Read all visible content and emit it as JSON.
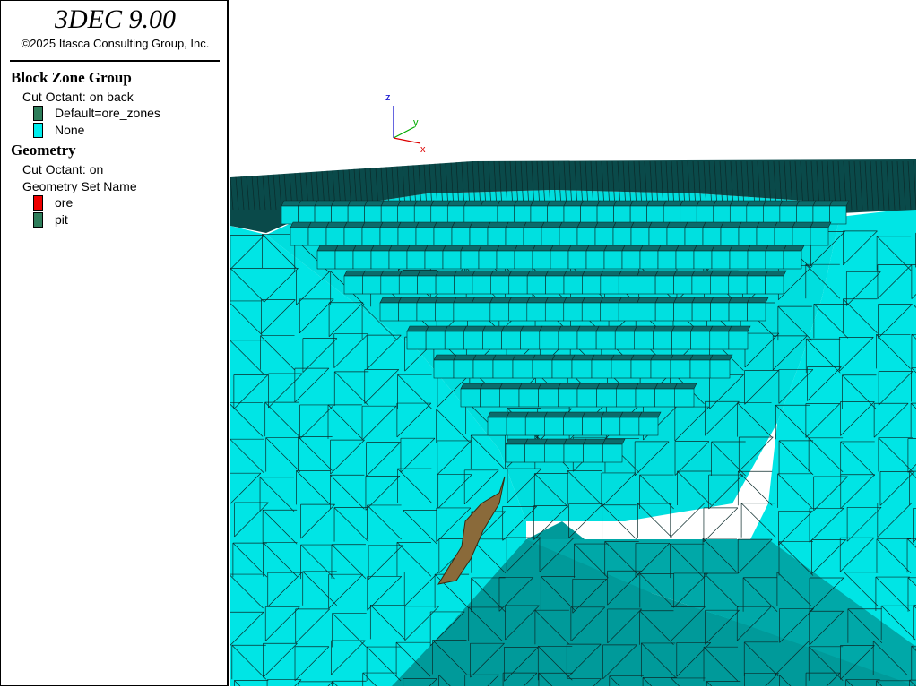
{
  "header": {
    "app_title": "3DEC 9.00",
    "copyright": "©2025 Itasca Consulting Group, Inc."
  },
  "legend": {
    "block_zone_group": {
      "title": "Block  Zone Group",
      "cut_octant": "Cut Octant: on back",
      "items": [
        {
          "label": "Default=ore_zones",
          "color": "#2e7d5a"
        },
        {
          "label": "None",
          "color": "#00eeee"
        }
      ]
    },
    "geometry": {
      "title": "Geometry",
      "cut_octant": "Cut Octant: on",
      "set_name_label": "Geometry Set Name",
      "items": [
        {
          "label": "ore",
          "color": "#ee0000"
        },
        {
          "label": "pit",
          "color": "#2e7d5a"
        }
      ]
    }
  },
  "axes": {
    "z": "z",
    "y": "y",
    "x": "x",
    "z_color": "#0000cc",
    "y_color": "#00aa00",
    "x_color": "#dd0000"
  },
  "model_colors": {
    "zone": "#00e5e5",
    "zone_shadow": "#00b3b3",
    "floor": "#009a9a",
    "top": "#0a4a4a",
    "ore": "#8a6a3a",
    "mesh_line": "#0a2a2a"
  }
}
